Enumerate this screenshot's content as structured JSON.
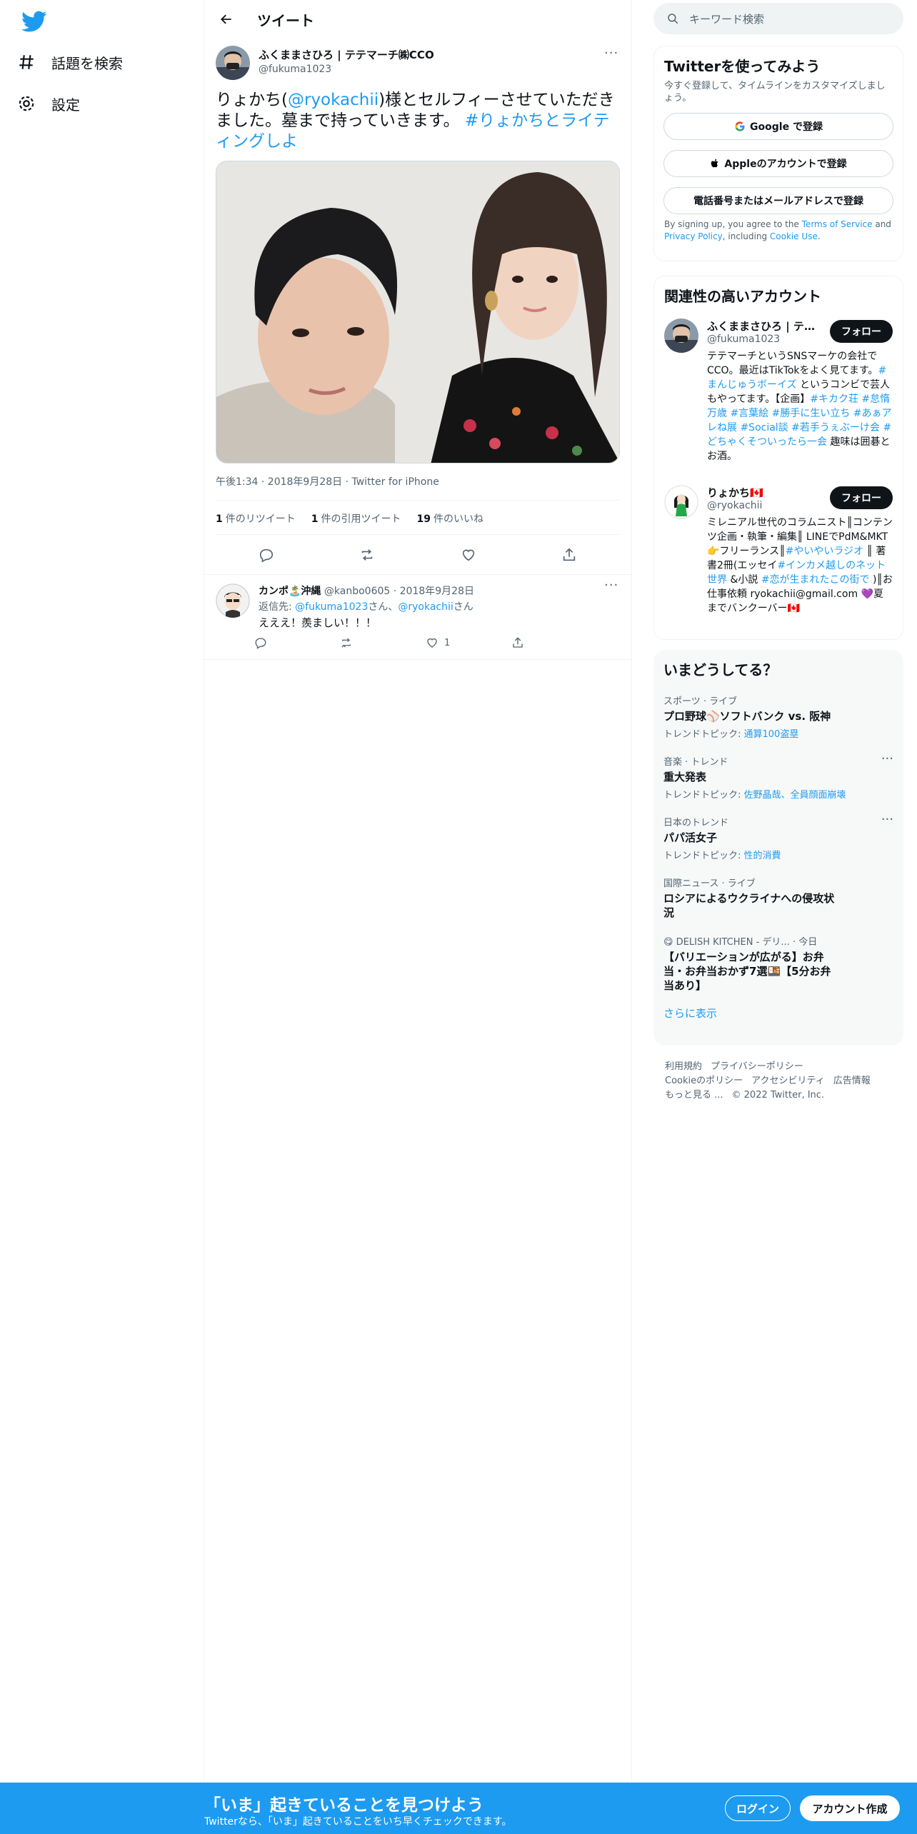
{
  "nav": {
    "explore_label": "話題を検索",
    "settings_label": "設定"
  },
  "header": {
    "title": "ツイート"
  },
  "tweet": {
    "author_name": "ふくままさひろ | テテマーチ㈱CCO",
    "author_handle": "@fukuma1023",
    "text_pre": "りょかち(",
    "text_mention": "@ryokachii",
    "text_mid": ")様とセルフィーさせていただきました。墓まで持っていきます。 ",
    "text_hashtag": "#りょかちとライティングしよ",
    "meta": "午後1:34 · 2018年9月28日 · Twitter for iPhone",
    "retweets_count": "1",
    "retweets_label": "件のリツイート",
    "quotes_count": "1",
    "quotes_label": "件の引用ツイート",
    "likes_count": "19",
    "likes_label": "件のいいね"
  },
  "reply": {
    "name": "カンポ🏝️沖縄",
    "handle": "@kanbo0605",
    "date": "· 2018年9月28日",
    "reply_to_label": "返信先: ",
    "reply_to_1": "@fukuma1023",
    "reply_to_sep": "さん、",
    "reply_to_2": "@ryokachii",
    "reply_to_end": "さん",
    "text": "えええ！羨ましい！！！",
    "like_count": "1"
  },
  "search": {
    "placeholder": "キーワード検索"
  },
  "signup_card": {
    "title": "Twitterを使ってみよう",
    "subtitle": "今すぐ登録して、タイムラインをカスタマイズしましょう。",
    "google_label": "Google で登録",
    "apple_label": "Appleのアカウントで登録",
    "phone_label": "電話番号またはメールアドレスで登録",
    "legal_pre": "By signing up, you agree to the ",
    "legal_tos": "Terms of Service",
    "legal_and": " and ",
    "legal_privacy": "Privacy Policy",
    "legal_including": ", including ",
    "legal_cookie": "Cookie Use",
    "legal_end": "."
  },
  "related": {
    "title": "関連性の高いアカウント",
    "follow_label": "フォロー",
    "accounts": [
      {
        "name": "ふくままさひろ | テテマーチ㈱CCO",
        "handle": "@fukuma1023",
        "bio_1": "テテマーチというSNSマーケの会社でCCO。最近はTikTokをよく見てます。",
        "bio_tag_1": "#まんじゅうボーイズ",
        "bio_2": " というコンビで芸人もやってます。【企画】",
        "bio_tag_2": "#キカク荘 #怠惰万歳 #言葉絵 #勝手に生い立ち #あぁアレね展 #Social談 #若手うぇぶーけ会 #どちゃくそついったら一会",
        "bio_3": " 趣味は囲碁とお酒。"
      },
      {
        "name": "りょかち🇨🇦",
        "handle": "@ryokachii",
        "bio_1": "ミレニアル世代のコラムニスト║コンテンツ企画・執筆・編集║ LINEでPdM&MKT👉フリーランス║",
        "bio_tag_1": "#やいやいラジオ",
        "bio_2": " ║ 著書2冊(エッセイ",
        "bio_tag_2": "#インカメ越しのネット世界",
        "bio_3": " &小説 ",
        "bio_tag_3": "#恋が生まれたこの街で",
        "bio_4": " )║お仕事依頼 ryokachii@gmail.com 💜夏までバンクーバー🇨🇦"
      }
    ]
  },
  "trends": {
    "title": "いまどうしてる？",
    "items": [
      {
        "context": "スポーツ · ライブ",
        "title": "プロ野球⚾ソフトバンク vs. 阪神",
        "topic_label": "トレンドトピック: ",
        "topic": "通算100盗塁"
      },
      {
        "context": "音楽 · トレンド",
        "title": "重大発表",
        "topic_label": "トレンドトピック: ",
        "topic": "佐野晶哉、全員顔面崩壊"
      },
      {
        "context": "日本のトレンド",
        "title": "パパ活女子",
        "topic_label": "トレンドトピック: ",
        "topic": "性的消費"
      },
      {
        "context": "国際ニュース · ライブ",
        "title": "ロシアによるウクライナへの侵攻状況"
      },
      {
        "context": "😋 DELISH KITCHEN - デリ... · 今日",
        "title": "【バリエーションが広がる】お弁当・お弁当おかず7選🍱【5分お弁当あり】"
      }
    ],
    "show_more": "さらに表示"
  },
  "footer": {
    "links": [
      "利用規約",
      "プライバシーポリシー",
      "Cookieのポリシー",
      "アクセシビリティ",
      "広告情報",
      "もっと見る ..."
    ],
    "copyright": "© 2022 Twitter, Inc."
  },
  "bottombar": {
    "title": "「いま」起きていることを見つけよう",
    "subtitle": "Twitterなら、「いま」起きていることをいち早くチェックできます。",
    "login_label": "ログイン",
    "signup_label": "アカウント作成"
  },
  "colors": {
    "accent": "#1d9bf0",
    "text": "#0f1419",
    "secondary": "#536471",
    "border": "#eff3f4"
  }
}
